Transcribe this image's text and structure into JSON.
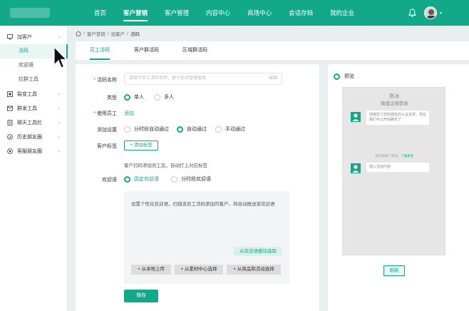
{
  "nav": {
    "items": [
      "首页",
      "客户营销",
      "客户管理",
      "内容中心",
      "商场中心",
      "会话存档",
      "我的企业"
    ],
    "active_index": 1
  },
  "colors": {
    "brand": "#12a98a",
    "required": "#f04a4a"
  },
  "sidebar": {
    "groups": [
      {
        "label": "加客户",
        "icon": "add-customer-icon",
        "expanded": true,
        "children": [
          "活码",
          "欢迎语",
          "拉群工具"
        ]
      },
      {
        "label": "裂变工具",
        "icon": "fission-icon"
      },
      {
        "label": "群发工具",
        "icon": "mass-send-icon"
      },
      {
        "label": "聊天工具栏",
        "icon": "chat-toolbar-icon"
      },
      {
        "label": "历史朋友圈",
        "icon": "moments-history-icon"
      },
      {
        "label": "客服朋友圈",
        "icon": "service-moments-icon"
      }
    ],
    "active_child": "活码"
  },
  "breadcrumb": [
    "客户营销",
    "加客户",
    "活码"
  ],
  "tabs": {
    "items": [
      "员工活码",
      "客户群活码",
      "区域群活码"
    ],
    "active_index": 0
  },
  "form": {
    "name": {
      "label": "活码名称",
      "placeholder": "请填写员工活码名称，便于后续管理查找",
      "count": "0/30"
    },
    "type": {
      "label": "类型",
      "options": [
        "单人",
        "多人"
      ],
      "selected": "单人"
    },
    "staff": {
      "label": "使用员工",
      "action": "添加"
    },
    "add_setting": {
      "label": "添加设置",
      "options": [
        "分时段自动通过",
        "自动通过",
        "手动通过"
      ],
      "selected": "自动通过"
    },
    "tags": {
      "label": "客户标签",
      "button": "+ 添加标签",
      "hint": "客户扫码添加员工后，自动打上对应标签"
    },
    "welcome": {
      "label": "欢迎语",
      "options": [
        "固定欢迎语",
        "分时段欢迎语"
      ],
      "selected": "固定欢迎语",
      "placeholder": "设置个性化欢迎语，扫描该员工活码添加的客户，将自动推送该欢迎语",
      "pick": "从欢迎语模块选取",
      "uploads": [
        "+ 从本地上传",
        "+ 从素材中心选择",
        "+ 从商品和活动选择"
      ]
    },
    "save": "保存"
  },
  "preview": {
    "title": "预览",
    "phone_title": "陈冰",
    "phone_sub": "微盛企微管家",
    "bubble1": "感谢您了您的朋友的认证请求，现在我们可以开始聊天了",
    "sys_prefix": "你已添加了陈冰，",
    "sys_link": "了解更多",
    "bubble2": "插入活动内容",
    "refresh": "刷新"
  }
}
